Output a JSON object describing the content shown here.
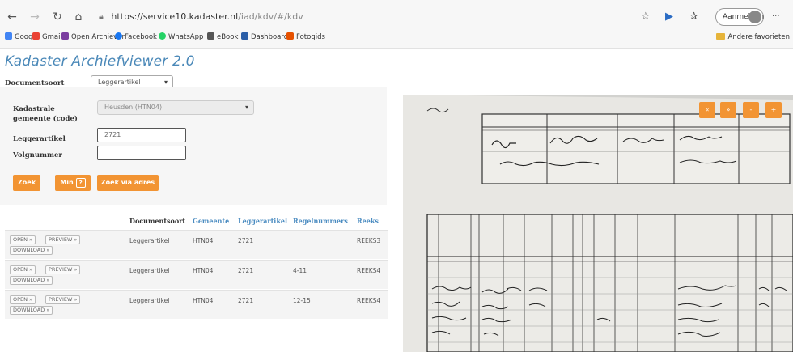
{
  "browser": {
    "url_host": "https://service10.kadaster.nl",
    "url_path": "/iad/kdv/#/kdv",
    "signin_label": "Aanmelden",
    "more": "···",
    "bookmarks": [
      {
        "label": "Google",
        "color": "#4285f4"
      },
      {
        "label": "Gmail",
        "color": "#ea4335"
      },
      {
        "label": "Open Archieven",
        "color": "#7b3ea0"
      },
      {
        "label": "Facebook",
        "color": "#1877f2"
      },
      {
        "label": "WhatsApp",
        "color": "#25d366"
      },
      {
        "label": "eBook",
        "color": "#555555"
      },
      {
        "label": "Dashboard",
        "color": "#2b5ea7"
      },
      {
        "label": "Fotogids",
        "color": "#e65100"
      }
    ],
    "other_favorites": "Andere favorieten"
  },
  "app": {
    "title": "Kadaster Archiefviewer 2.0"
  },
  "form": {
    "documentsoort_label": "Documentsoort",
    "documentsoort_value": "Leggerartikel",
    "kadastrale_label_line1": "Kadastrale",
    "kadastrale_label_line2": "gemeente (code)",
    "kadastrale_value": "Heusden (HTN04)",
    "leggerartikel_label": "Leggerartikel",
    "leggerartikel_value": "2721",
    "volgnummer_label": "Volgnummer",
    "volgnummer_value": "",
    "search_button": "Zoek",
    "min_button": "Min",
    "min_badge": "?",
    "search_other_button": "Zoek via adres"
  },
  "results": {
    "headers": [
      "Documentsoort",
      "Gemeente",
      "Leggerartikel",
      "Regelnummers",
      "Reeks"
    ],
    "action_open": "OPEN »",
    "action_preview": "PREVIEW »",
    "action_download": "DOWNLOAD »",
    "rows": [
      {
        "documentsoort": "Leggerartikel",
        "gemeente": "HTN04",
        "leggerartikel": "2721",
        "regelnummers": "",
        "reeks": "REEKS3"
      },
      {
        "documentsoort": "Leggerartikel",
        "gemeente": "HTN04",
        "leggerartikel": "2721",
        "regelnummers": "4-11",
        "reeks": "REEKS4"
      },
      {
        "documentsoort": "Leggerartikel",
        "gemeente": "HTN04",
        "leggerartikel": "2721",
        "regelnummers": "12-15",
        "reeks": "REEKS4"
      }
    ]
  },
  "viewer": {
    "tools": [
      "«",
      "»",
      "-",
      "+"
    ]
  }
}
